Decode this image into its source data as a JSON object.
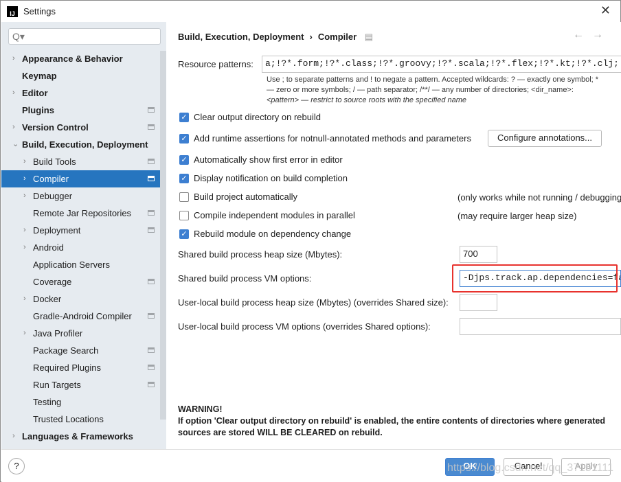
{
  "window": {
    "title": "Settings",
    "app_icon": "IJ"
  },
  "search": {
    "placeholder": "Q▾"
  },
  "sidebar": {
    "items": [
      {
        "label": "Appearance & Behavior",
        "level": 0,
        "chevron": "right",
        "mark": false
      },
      {
        "label": "Keymap",
        "level": 0,
        "chevron": "",
        "mark": false
      },
      {
        "label": "Editor",
        "level": 0,
        "chevron": "right",
        "mark": false
      },
      {
        "label": "Plugins",
        "level": 0,
        "chevron": "",
        "mark": true
      },
      {
        "label": "Version Control",
        "level": 0,
        "chevron": "right",
        "mark": true
      },
      {
        "label": "Build, Execution, Deployment",
        "level": 0,
        "chevron": "down",
        "mark": false
      },
      {
        "label": "Build Tools",
        "level": 1,
        "chevron": "right",
        "mark": true
      },
      {
        "label": "Compiler",
        "level": 1,
        "chevron": "right",
        "mark": true,
        "selected": true
      },
      {
        "label": "Debugger",
        "level": 1,
        "chevron": "right",
        "mark": false
      },
      {
        "label": "Remote Jar Repositories",
        "level": 1,
        "chevron": "",
        "mark": true
      },
      {
        "label": "Deployment",
        "level": 1,
        "chevron": "right",
        "mark": true
      },
      {
        "label": "Android",
        "level": 1,
        "chevron": "right",
        "mark": false
      },
      {
        "label": "Application Servers",
        "level": 1,
        "chevron": "",
        "mark": false
      },
      {
        "label": "Coverage",
        "level": 1,
        "chevron": "",
        "mark": true
      },
      {
        "label": "Docker",
        "level": 1,
        "chevron": "right",
        "mark": false
      },
      {
        "label": "Gradle-Android Compiler",
        "level": 1,
        "chevron": "",
        "mark": true
      },
      {
        "label": "Java Profiler",
        "level": 1,
        "chevron": "right",
        "mark": false
      },
      {
        "label": "Package Search",
        "level": 1,
        "chevron": "",
        "mark": true
      },
      {
        "label": "Required Plugins",
        "level": 1,
        "chevron": "",
        "mark": true
      },
      {
        "label": "Run Targets",
        "level": 1,
        "chevron": "",
        "mark": true
      },
      {
        "label": "Testing",
        "level": 1,
        "chevron": "",
        "mark": false
      },
      {
        "label": "Trusted Locations",
        "level": 1,
        "chevron": "",
        "mark": false
      },
      {
        "label": "Languages & Frameworks",
        "level": 0,
        "chevron": "right",
        "mark": false
      }
    ]
  },
  "breadcrumb": {
    "parent": "Build, Execution, Deployment",
    "sep": "›",
    "current": "Compiler"
  },
  "resource": {
    "label": "Resource patterns:",
    "value": "a;!?*.form;!?*.class;!?*.groovy;!?*.scala;!?*.flex;!?*.kt;!?*.clj;!?*.aj",
    "hint1": "Use ; to separate patterns and ! to negate a pattern. Accepted wildcards: ? — exactly one symbol; *",
    "hint2": "— zero or more symbols; / — path separator; /**/ — any number of directories; <dir_name>:",
    "hint3": "<pattern> — restrict to source roots with the specified name"
  },
  "checkboxes": [
    {
      "label": "Clear output directory on rebuild",
      "checked": true
    },
    {
      "label": "Add runtime assertions for notnull-annotated methods and parameters",
      "checked": true
    },
    {
      "label": "Automatically show first error in editor",
      "checked": true
    },
    {
      "label": "Display notification on build completion",
      "checked": true
    },
    {
      "label": "Build project automatically",
      "checked": false,
      "note": "(only works while not running / debugging)"
    },
    {
      "label": "Compile independent modules in parallel",
      "checked": false,
      "note": "(may require larger heap size)"
    },
    {
      "label": "Rebuild module on dependency change",
      "checked": true
    }
  ],
  "configure_button": "Configure annotations...",
  "heap": {
    "label": "Shared build process heap size (Mbytes):",
    "value": "700"
  },
  "vm": {
    "label": "Shared build process VM options:",
    "value": "-Djps.track.ap.dependencies=false"
  },
  "user_heap": {
    "label": "User-local build process heap size (Mbytes) (overrides Shared size):",
    "value": ""
  },
  "user_vm": {
    "label": "User-local build process VM options (overrides Shared options):",
    "value": ""
  },
  "warning": {
    "title": "WARNING!",
    "line1": "If option 'Clear output directory on rebuild' is enabled, the entire contents of directories where generated",
    "line2": "sources are stored WILL BE CLEARED on rebuild."
  },
  "footer": {
    "help": "?",
    "ok": "OK",
    "cancel": "Cancel",
    "apply": "Apply"
  },
  "watermark": "https://blog.csdn.net/qq_37151111",
  "colors": {
    "accent": "#2675bf",
    "highlight": "#e8322d",
    "checkbox": "#3d7fd1"
  }
}
